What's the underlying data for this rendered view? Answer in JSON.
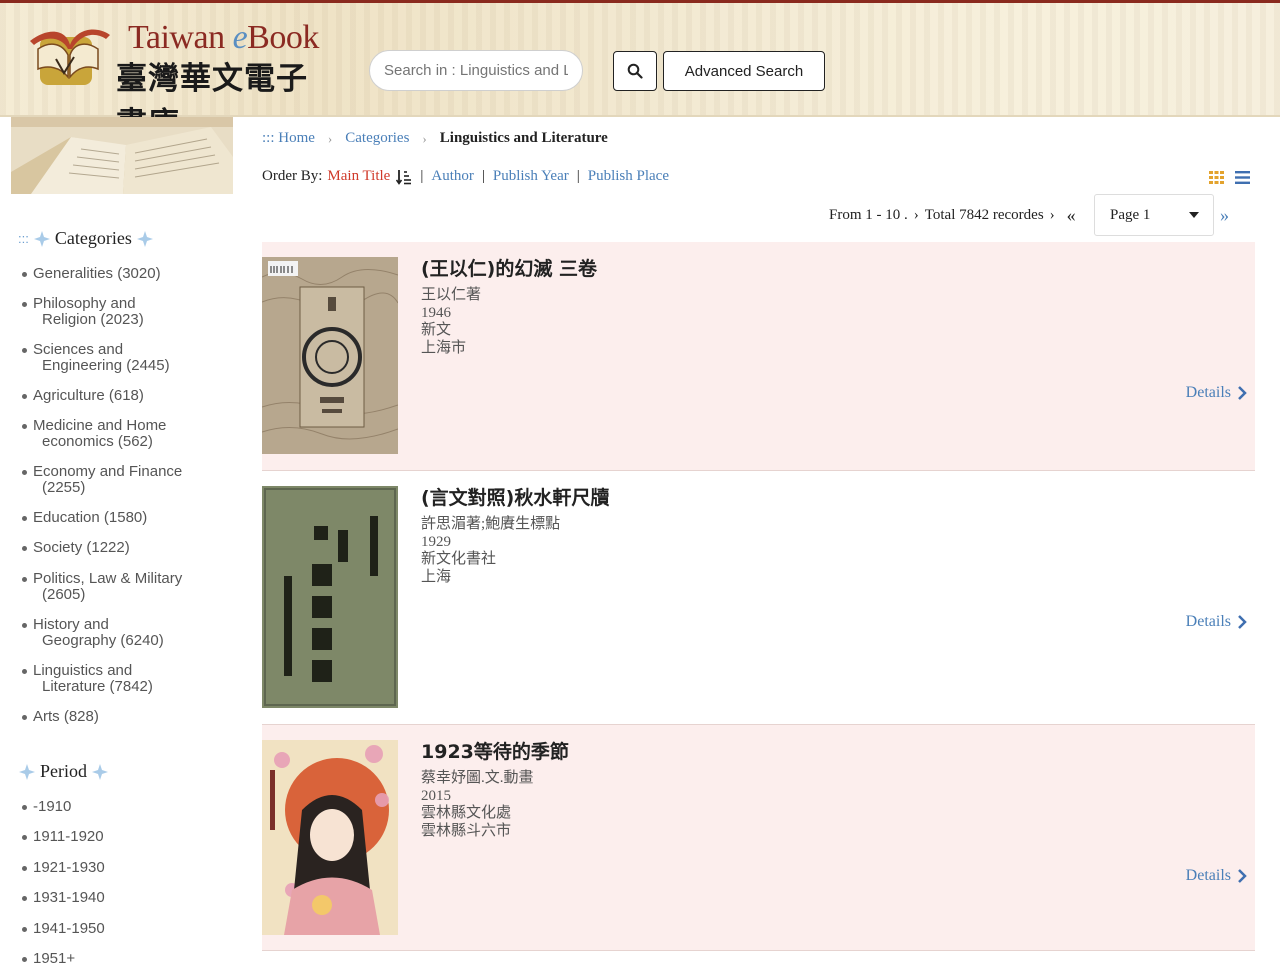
{
  "header": {
    "logo_title_a": "Taiwan ",
    "logo_title_e": "e",
    "logo_title_b": "Book",
    "logo_subtitle": "臺灣華文電子書庫",
    "search_placeholder": "Search in : Linguistics and Literature",
    "advanced_search_label": "Advanced Search"
  },
  "sidebar": {
    "categories_heading_dots": ":::",
    "categories_heading": "Categories",
    "categories": [
      {
        "label": "Generalities (3020)"
      },
      {
        "label": "Philosophy and",
        "label2": "Religion (2023)"
      },
      {
        "label": "Sciences and",
        "label2": "Engineering (2445)"
      },
      {
        "label": "Agriculture (618)"
      },
      {
        "label": "Medicine and Home",
        "label2": "economics (562)"
      },
      {
        "label": "Economy and Finance",
        "label2": "(2255)"
      },
      {
        "label": "Education (1580)"
      },
      {
        "label": "Society (1222)"
      },
      {
        "label": "Politics, Law & Military",
        "label2": "(2605)"
      },
      {
        "label": "History and",
        "label2": "Geography (6240)"
      },
      {
        "label": "Linguistics and",
        "label2": "Literature (7842)"
      },
      {
        "label": "Arts (828)"
      }
    ],
    "period_heading": "Period",
    "periods": [
      "-1910",
      "1911-1920",
      "1921-1930",
      "1931-1940",
      "1941-1950",
      "1951+"
    ]
  },
  "breadcrumb": {
    "home": "::: Home",
    "categories": "Categories",
    "current": "Linguistics and Literature"
  },
  "order": {
    "label": "Order By:",
    "main_title": "Main Title",
    "author": "Author",
    "publish_year": "Publish Year",
    "publish_place": "Publish Place"
  },
  "pager": {
    "range": "From 1 - 10 .",
    "total": "Total 7842 recordes",
    "page_value": "Page 1"
  },
  "books": [
    {
      "title": "(王以仁)的幻滅 三卷",
      "author": "王以仁著",
      "year": "1946",
      "publisher": "新文",
      "place": "上海市",
      "details": "Details"
    },
    {
      "title": "(言文對照)秋水軒尺牘",
      "author": "許思湄著;鮑賡生標點",
      "year": "1929",
      "publisher": "新文化書社",
      "place": "上海",
      "details": "Details"
    },
    {
      "title": "1923等待的季節",
      "author": "蔡幸妤圖.文.動畫",
      "year": "2015",
      "publisher": "雲林縣文化處",
      "place": "雲林縣斗六市",
      "details": "Details"
    }
  ],
  "colors": {
    "brand_red": "#8b2a22",
    "link_blue": "#4a7fb8",
    "active_order": "#d03a2a",
    "row_shade": "#fceeed"
  }
}
